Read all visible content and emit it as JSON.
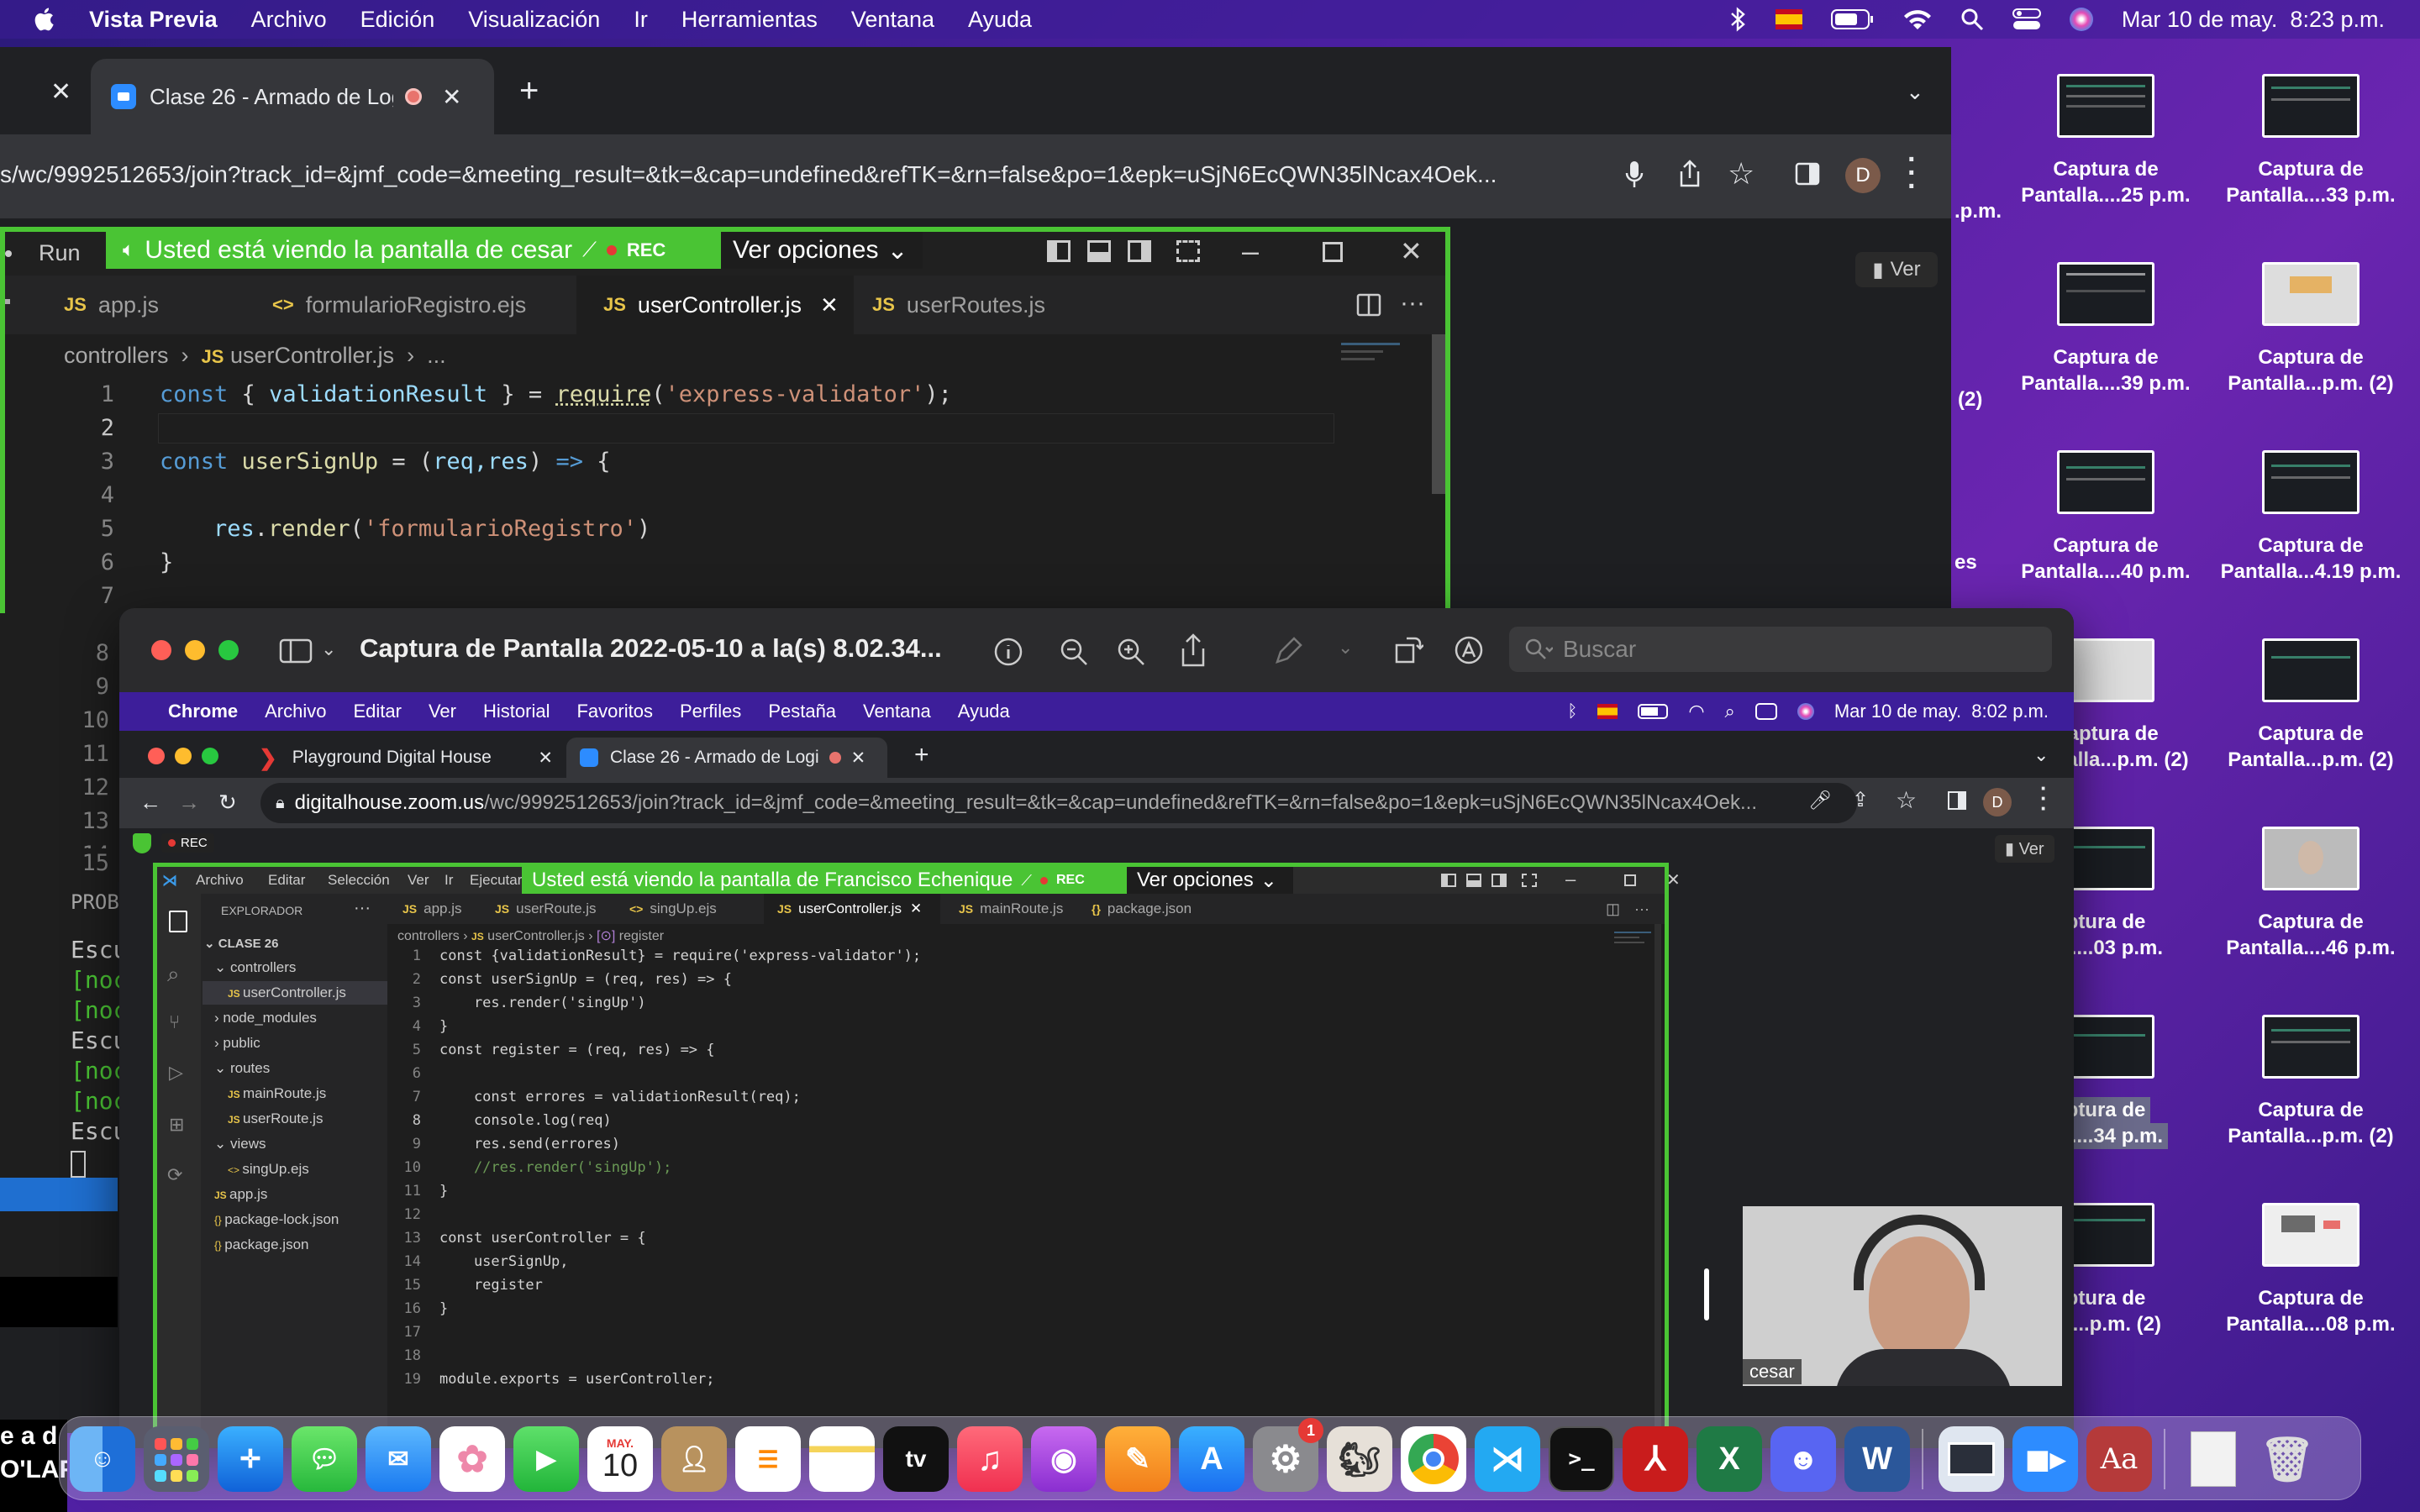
{
  "menubar": {
    "app": "Vista Previa",
    "items": [
      "Archivo",
      "Edición",
      "Visualización",
      "Ir",
      "Herramientas",
      "Ventana",
      "Ayuda"
    ],
    "datetime": "Mar 10 de may.  8:23 p.m."
  },
  "desktop": {
    "icons": [
      {
        "l1": "Captura de",
        "l2": "Pantalla....25 p.m."
      },
      {
        "l1": "Captura de",
        "l2": "Pantalla....33 p.m."
      },
      {
        "l1": "Captura de",
        "l2": "Pantalla....39 p.m."
      },
      {
        "l1": "Captura de",
        "l2": "Pantalla...p.m. (2)"
      },
      {
        "l1": "Captura de",
        "l2": "Pantalla....40 p.m."
      },
      {
        "l1": "Captura de",
        "l2": "Pantalla...4.19 p.m."
      },
      {
        "l1": "Captura de",
        "l2": "Pantalla...p.m. (2)"
      },
      {
        "l1": "Captura de",
        "l2": "Pantalla...p.m. (2)"
      },
      {
        "l1": "ptura de",
        "l2": "lla....03 p.m."
      },
      {
        "l1": "Captura de",
        "l2": "Pantalla....46 p.m."
      },
      {
        "l1": "ptura de",
        "l2": "lla....34 p.m."
      },
      {
        "l1": "Captura de",
        "l2": "Pantalla...p.m. (2)"
      },
      {
        "l1": "ptura de",
        "l2": "lla...p.m. (2)"
      },
      {
        "l1": "Captura de",
        "l2": "Pantalla....08 p.m."
      }
    ],
    "partial_labels": {
      "a": ".p.m.",
      "b": "(2)",
      "c": "es"
    }
  },
  "chrome_main": {
    "tab_title": "Clase 26 - Armado de Logi",
    "new_tab": "+",
    "url": "s/wc/9992512653/join?track_id=&jmf_code=&meeting_result=&tk=&cap=undefined&refTK=&rn=false&po=1&epk=uSjN6EcQWN35lNcax4Oek...",
    "avatar": "D",
    "ver_label": "Ver"
  },
  "vscode_main": {
    "menu_run": "Run",
    "share_banner": "Usted está viendo la pantalla de cesar",
    "rec": "REC",
    "options": "Ver opciones",
    "tabs": [
      "app.js",
      "formularioRegistro.ejs",
      "userController.js",
      "userRoutes.js"
    ],
    "breadcrumb": [
      "controllers",
      "userController.js",
      "..."
    ],
    "line_numbers": [
      "1",
      "2",
      "3",
      "4",
      "5",
      "6",
      "7",
      "8",
      "9",
      "10",
      "11",
      "12",
      "13",
      "14",
      "15"
    ],
    "code": {
      "l1_a": "const",
      "l1_b": "{ ",
      "l1_c": "validationResult",
      "l1_d": " } = ",
      "l1_e": "require",
      "l1_f": "(",
      "l1_g": "'express-validator'",
      "l1_h": ");",
      "l3_a": "const",
      "l3_b": "userSignUp",
      "l3_c": " = (",
      "l3_d": "req,res",
      "l3_e": ") ",
      "l3_f": "=>",
      "l3_g": " {",
      "l5_a": "res",
      "l5_b": ".",
      "l5_c": "render",
      "l5_d": "(",
      "l5_e": "'formularioRegistro'",
      "l5_f": ")",
      "l6": "}"
    }
  },
  "terminal_partial": {
    "header": "PROB",
    "lines": [
      "Escu",
      "[noc",
      "[noc",
      "Escu",
      "[noc",
      "[noc",
      "Escu"
    ]
  },
  "preview": {
    "title": "Captura de Pantalla 2022-05-10 a la(s) 8.02.34...",
    "search_placeholder": "Buscar"
  },
  "inner": {
    "menubar": {
      "app": "Chrome",
      "items": [
        "Archivo",
        "Editar",
        "Ver",
        "Historial",
        "Favoritos",
        "Perfiles",
        "Pestaña",
        "Ventana",
        "Ayuda"
      ],
      "datetime": "Mar 10 de may.  8:02 p.m."
    },
    "tabs": [
      "Playground Digital House",
      "Clase 26 - Armado de Logi"
    ],
    "url_host": "digitalhouse.zoom.us",
    "url_path": "/wc/9992512653/join?track_id=&jmf_code=&meeting_result=&tk=&cap=undefined&refTK=&rn=false&po=1&epk=uSjN6EcQWN35lNcax4Oek...",
    "avatar": "D",
    "rec": "REC",
    "ver_label": "Ver",
    "vscode": {
      "menu": [
        "Archivo",
        "Editar",
        "Selección",
        "Ver",
        "Ir",
        "Ejecutar"
      ],
      "share_banner": "Usted está viendo la pantalla de Francisco Echenique",
      "rec": "REC",
      "options": "Ver opciones",
      "explorer_title": "EXPLORADOR",
      "project": "CLASE 26",
      "tree": [
        "controllers",
        "userController.js",
        "node_modules",
        "public",
        "routes",
        "mainRoute.js",
        "userRoute.js",
        "views",
        "singUp.ejs",
        "app.js",
        "package-lock.json",
        "package.json"
      ],
      "tabs": [
        "app.js",
        "userRoute.js",
        "singUp.ejs",
        "userController.js",
        "mainRoute.js",
        "package.json"
      ],
      "breadcrumb": [
        "controllers",
        "userController.js",
        "register"
      ],
      "line_numbers": [
        "1",
        "2",
        "3",
        "4",
        "5",
        "6",
        "7",
        "8",
        "9",
        "10",
        "11",
        "12",
        "13",
        "14",
        "15",
        "16",
        "17",
        "18",
        "19"
      ],
      "code": [
        "const {validationResult} = require('express-validator');",
        "const userSignUp = (req, res) => {",
        "    res.render('singUp')",
        "}",
        "const register = (req, res) => {",
        "",
        "    const errores = validationResult(req);",
        "    console.log(req)",
        "    res.send(errores)",
        "    //res.render('singUp');",
        "}",
        "",
        "const userController = {",
        "    userSignUp,",
        "    register",
        "}",
        "",
        "",
        "module.exports = userController;"
      ]
    },
    "camera_name": "cesar"
  },
  "bottom_left": {
    "l1": "e a d",
    "l2": "O'LAFR"
  },
  "dock": {
    "calendar_month": "MAY.",
    "calendar_day": "10",
    "tv_label": "tv",
    "settings_badge": "1",
    "dict_label": "Aa"
  },
  "colors": {
    "share_green": "#4ac434",
    "rec_red": "#e53935",
    "desktop_purple": "#4a1fa0",
    "vscode_bg": "#1e1e1e",
    "chrome_bg": "#202124"
  }
}
